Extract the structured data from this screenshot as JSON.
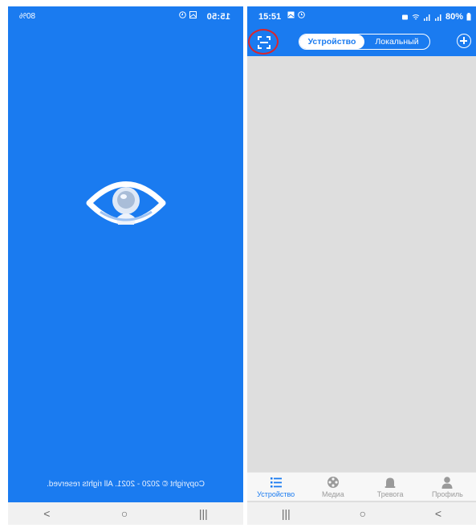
{
  "left_screen": {
    "status": {
      "time": "15:50",
      "battery": "80%"
    },
    "copyright": "Copyright © 2020 - 2021. All rights reserved.",
    "nav": {
      "recent": "|||",
      "home": "○",
      "back": "<"
    }
  },
  "right_screen": {
    "status": {
      "time": "15:51",
      "battery": "80%"
    },
    "toolbar": {
      "tabs": [
        {
          "label": "Устройство",
          "active": true
        },
        {
          "label": "Локальный",
          "active": false
        }
      ]
    },
    "bottom_tabs": [
      {
        "label": "Устройство",
        "icon": "list-icon",
        "active": true
      },
      {
        "label": "Медиа",
        "icon": "film-reel-icon",
        "active": false
      },
      {
        "label": "Тревога",
        "icon": "alarm-bell-icon",
        "active": false
      },
      {
        "label": "Профиль",
        "icon": "user-icon",
        "active": false
      }
    ],
    "nav": {
      "recent": "|||",
      "home": "○",
      "back": "<"
    }
  },
  "colors": {
    "primary": "#1a7bf0",
    "highlight": "#d9262c",
    "content_bg": "#dedede"
  }
}
